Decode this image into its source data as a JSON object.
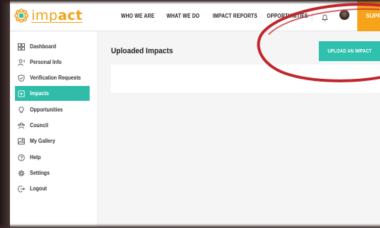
{
  "header": {
    "logo": {
      "prefix": "imp",
      "suffix": "act"
    },
    "nav": [
      {
        "label": "WHO WE ARE"
      },
      {
        "label": "WHAT WE DO"
      },
      {
        "label": "IMPACT REPORTS"
      },
      {
        "label": "OPPORTUNITIES"
      }
    ],
    "support_label": "SUPPORT"
  },
  "sidebar": {
    "items": [
      {
        "label": "Dashboard",
        "icon": "grid-icon",
        "active": false
      },
      {
        "label": "Personal Info",
        "icon": "user-icon",
        "active": false
      },
      {
        "label": "Verification Requests",
        "icon": "shield-check-icon",
        "active": false
      },
      {
        "label": "Impacts",
        "icon": "impact-icon",
        "active": true
      },
      {
        "label": "Opportunities",
        "icon": "bulb-icon",
        "active": false
      },
      {
        "label": "Council",
        "icon": "council-icon",
        "active": false
      },
      {
        "label": "My Gallery",
        "icon": "gallery-icon",
        "active": false
      },
      {
        "label": "Help",
        "icon": "help-icon",
        "active": false
      },
      {
        "label": "Settings",
        "icon": "gear-icon",
        "active": false
      },
      {
        "label": "Logout",
        "icon": "logout-icon",
        "active": false
      }
    ]
  },
  "main": {
    "title": "Uploaded Impacts",
    "upload_label": "UPLOAD AN IMPACT"
  },
  "colors": {
    "brand": "#f7a31a",
    "accent": "#2fbdaa",
    "annotation": "#c0272d"
  }
}
